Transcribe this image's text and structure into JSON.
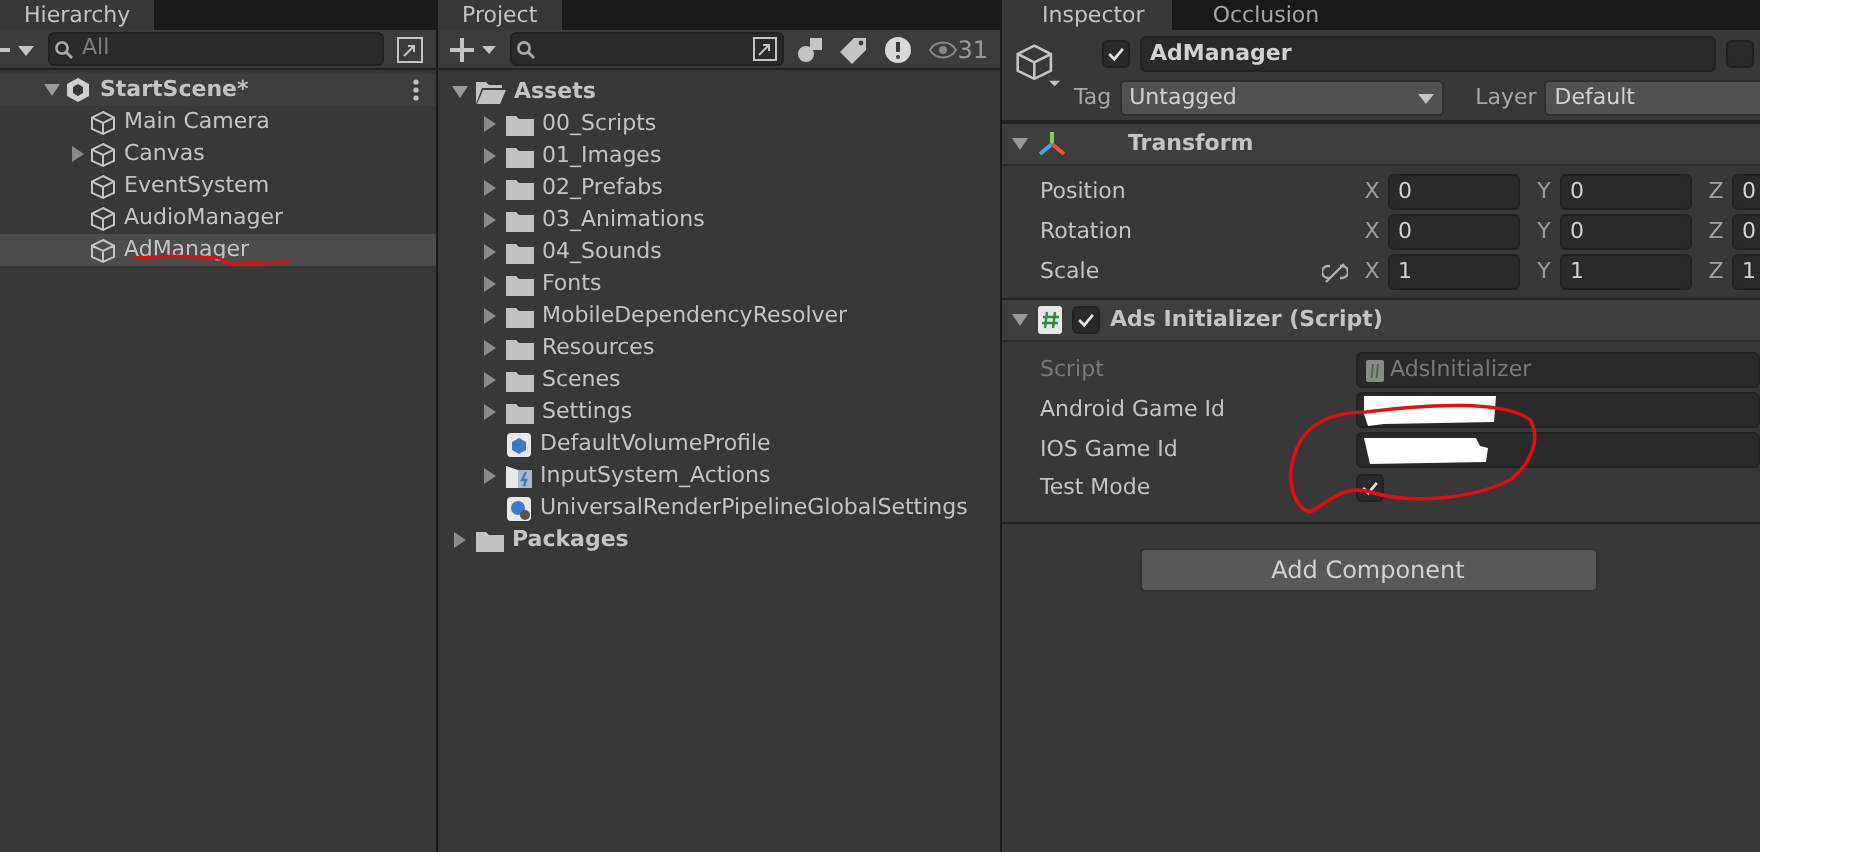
{
  "hierarchy": {
    "tab": "Hierarchy",
    "search": {
      "placeholder": "All"
    },
    "scene": {
      "name": "StartScene*",
      "expanded": true
    },
    "items": [
      {
        "name": "Main Camera",
        "has_children": false,
        "selected": false
      },
      {
        "name": "Canvas",
        "has_children": true,
        "selected": false
      },
      {
        "name": "EventSystem",
        "has_children": false,
        "selected": false
      },
      {
        "name": "AudioManager",
        "has_children": false,
        "selected": false
      },
      {
        "name": "AdManager",
        "has_children": false,
        "selected": true
      }
    ]
  },
  "project": {
    "tab": "Project",
    "hidden_count": "31",
    "tree": [
      {
        "name": "Assets",
        "kind": "folder",
        "expanded": true,
        "children": [
          {
            "name": "00_Scripts",
            "kind": "folder",
            "expanded": false
          },
          {
            "name": "01_Images",
            "kind": "folder",
            "expanded": false
          },
          {
            "name": "02_Prefabs",
            "kind": "folder",
            "expanded": false
          },
          {
            "name": "03_Animations",
            "kind": "folder",
            "expanded": false
          },
          {
            "name": "04_Sounds",
            "kind": "folder",
            "expanded": false
          },
          {
            "name": "Fonts",
            "kind": "folder",
            "expanded": false
          },
          {
            "name": "MobileDependencyResolver",
            "kind": "folder",
            "expanded": false
          },
          {
            "name": "Resources",
            "kind": "folder",
            "expanded": false
          },
          {
            "name": "Scenes",
            "kind": "folder",
            "expanded": false
          },
          {
            "name": "Settings",
            "kind": "folder",
            "expanded": false
          },
          {
            "name": "DefaultVolumeProfile",
            "kind": "volume-profile"
          },
          {
            "name": "InputSystem_Actions",
            "kind": "input-actions",
            "expanded": false
          },
          {
            "name": "UniversalRenderPipelineGlobalSettings",
            "kind": "pipeline-settings"
          }
        ]
      },
      {
        "name": "Packages",
        "kind": "folder",
        "expanded": false
      }
    ]
  },
  "inspector": {
    "tabs": [
      {
        "label": "Inspector",
        "selected": true
      },
      {
        "label": "Occlusion",
        "selected": false
      }
    ],
    "object": {
      "active": true,
      "name": "AdManager",
      "static": false,
      "tag": "Untagged",
      "layer": "Default"
    },
    "transform": {
      "title": "Transform",
      "expanded": true,
      "rows": [
        {
          "label": "Position",
          "kind": "plain",
          "values": [
            {
              "axis": "X",
              "value": "0"
            },
            {
              "axis": "Y",
              "value": "0"
            },
            {
              "axis": "Z",
              "value": "0"
            }
          ]
        },
        {
          "label": "Rotation",
          "kind": "plain",
          "values": [
            {
              "axis": "X",
              "value": "0"
            },
            {
              "axis": "Y",
              "value": "0"
            },
            {
              "axis": "Z",
              "value": "0"
            }
          ]
        },
        {
          "label": "Scale",
          "kind": "scale",
          "values": [
            {
              "axis": "X",
              "value": "1"
            },
            {
              "axis": "Y",
              "value": "1"
            },
            {
              "axis": "Z",
              "value": "1"
            }
          ]
        }
      ]
    },
    "script_component": {
      "title": "Ads Initializer (Script)",
      "enabled": true,
      "expanded": true,
      "fields": [
        {
          "label": "Script",
          "kind": "object",
          "value": "AdsInitializer",
          "disabled": true
        },
        {
          "label": "Android Game Id",
          "kind": "redacted",
          "disabled": false
        },
        {
          "label": "IOS Game Id",
          "kind": "redacted",
          "disabled": false
        },
        {
          "label": "Test Mode",
          "kind": "checkbox",
          "checked": true,
          "disabled": false
        }
      ]
    },
    "add_component": "Add Component",
    "labels": {
      "tag": "Tag",
      "layer": "Layer"
    }
  }
}
